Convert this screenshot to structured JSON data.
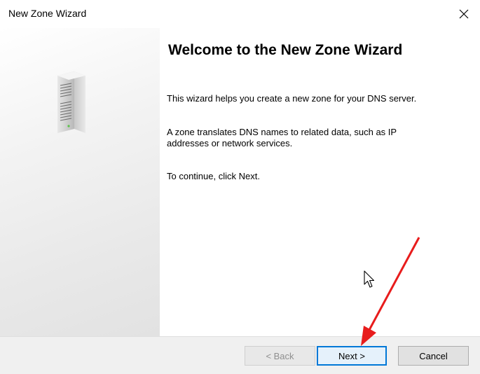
{
  "window": {
    "title": "New Zone Wizard",
    "close_icon": "close-icon"
  },
  "sidebar": {
    "image_icon": "server-icon"
  },
  "content": {
    "heading": "Welcome to the New Zone Wizard",
    "paragraph1": "This wizard helps you create a new zone for your DNS server.",
    "paragraph2": "A zone translates DNS names to related data, such as IP addresses or network services.",
    "paragraph3": "To continue, click Next."
  },
  "buttons": {
    "back": "< Back",
    "next": "Next >",
    "cancel": "Cancel"
  },
  "colors": {
    "accent": "#0078d7",
    "annotation_arrow": "#e81c1c",
    "footer_bg": "#f0f0f0"
  }
}
